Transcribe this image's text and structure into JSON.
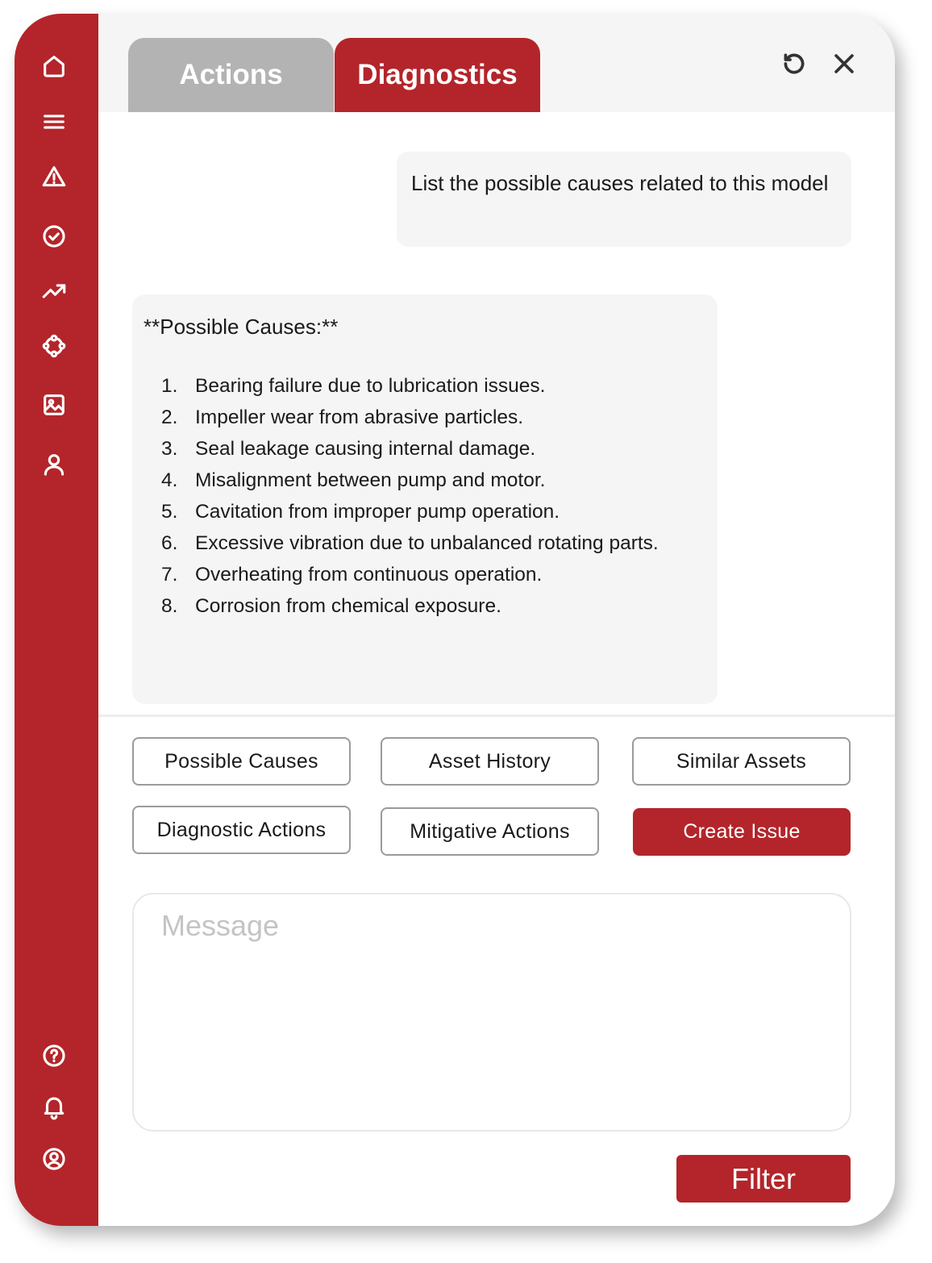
{
  "tabs": [
    {
      "label": "Actions",
      "active": false
    },
    {
      "label": "Diagnostics",
      "active": true
    }
  ],
  "header": {
    "refresh_icon": "refresh-icon",
    "close_icon": "close-icon"
  },
  "sidebar": {
    "top_icons": [
      "home-icon",
      "menu-icon",
      "warning-icon",
      "check-circle-icon",
      "trending-icon",
      "nodes-icon",
      "image-icon",
      "user-icon"
    ],
    "bottom_icons": [
      "help-icon",
      "bell-icon",
      "account-icon"
    ]
  },
  "chat": {
    "user_message": "List the possible causes related to this model",
    "bot_title": "**Possible Causes:**",
    "causes": [
      {
        "num": "1.",
        "text": "Bearing failure due to lubrication issues."
      },
      {
        "num": "2.",
        "text": "Impeller wear from abrasive particles."
      },
      {
        "num": "3.",
        "text": "Seal leakage causing internal damage."
      },
      {
        "num": "4.",
        "text": "Misalignment between pump and motor."
      },
      {
        "num": "5.",
        "text": "Cavitation from improper pump operation."
      },
      {
        "num": "6.",
        "text": "Excessive vibration due to unbalanced rotating parts."
      },
      {
        "num": "7.",
        "text": "Overheating from continuous operation."
      },
      {
        "num": "8.",
        "text": "Corrosion from chemical exposure."
      }
    ]
  },
  "quick_actions": {
    "possible_causes": "Possible Causes",
    "asset_history": "Asset History",
    "similar_assets": "Similar Assets",
    "diagnostic_actions": "Diagnostic Actions",
    "mitigative_actions": "Mitigative Actions",
    "create_issue": "Create Issue"
  },
  "message": {
    "placeholder": "Message"
  },
  "filter_label": "Filter",
  "colors": {
    "brand": "#b3252a",
    "inactive_tab": "#b3b3b3",
    "panel": "#f4f5f4"
  }
}
